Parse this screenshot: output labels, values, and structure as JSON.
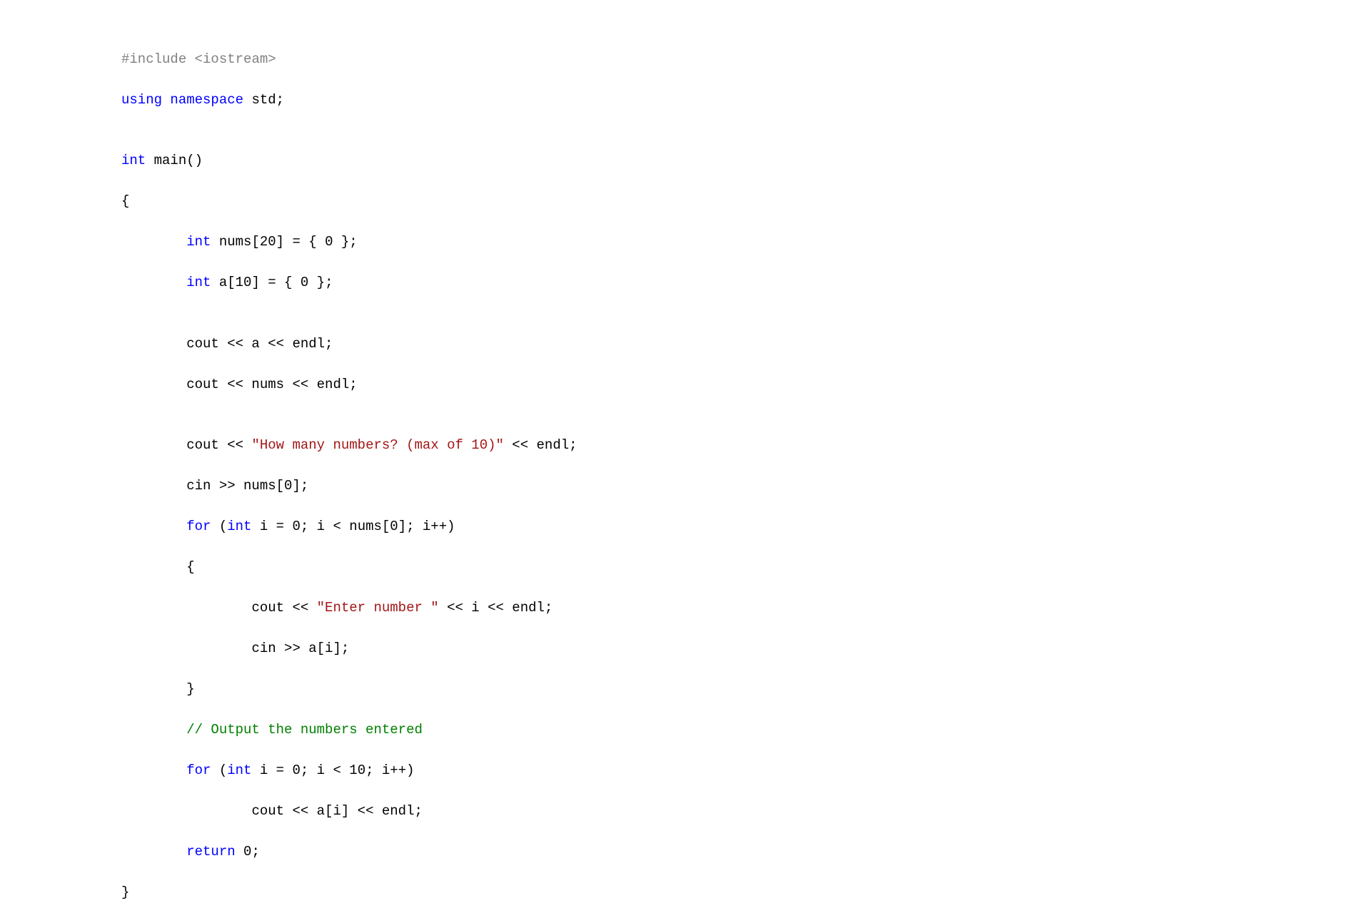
{
  "code": {
    "line1": {
      "include": "#include ",
      "iostream": "<iostream>"
    },
    "line2": {
      "using": "using",
      "namespace": "namespace",
      "std": " std;"
    },
    "line3": "",
    "line4": {
      "int": "int",
      "main": " main()"
    },
    "line5": "{",
    "line6": {
      "indent": "        ",
      "int": "int",
      "rest": " nums[20] = { 0 };"
    },
    "line7": {
      "indent": "        ",
      "int": "int",
      "rest": " a[10] = { 0 };"
    },
    "line8": "",
    "line9": {
      "indent": "        ",
      "rest": "cout << a << endl;"
    },
    "line10": {
      "indent": "        ",
      "rest": "cout << nums << endl;"
    },
    "line11": "",
    "line12": {
      "indent": "        ",
      "cout": "cout << ",
      "str": "\"How many numbers? (max of 10)\"",
      "rest": " << endl;"
    },
    "line13": {
      "indent": "        ",
      "rest": "cin >> nums[0];"
    },
    "line14": {
      "indent": "        ",
      "for": "for",
      "paren": " (",
      "int": "int",
      "rest": " i = 0; i < nums[0]; i++)"
    },
    "line15": {
      "indent": "        ",
      "brace": "{"
    },
    "line16": {
      "indent": "                ",
      "cout": "cout << ",
      "str": "\"Enter number \"",
      "rest": " << i << endl;"
    },
    "line17": {
      "indent": "                ",
      "rest": "cin >> a[i];"
    },
    "line18": {
      "indent": "        ",
      "brace": "}"
    },
    "line19": {
      "indent": "        ",
      "comment": "// Output the numbers entered"
    },
    "line20": {
      "indent": "        ",
      "for": "for",
      "paren": " (",
      "int": "int",
      "rest": " i = 0; i < 10; i++)"
    },
    "line21": {
      "indent": "                ",
      "rest": "cout << a[i] << endl;"
    },
    "line22": {
      "indent": "        ",
      "return": "return",
      "rest": " 0;"
    },
    "line23": "}"
  }
}
